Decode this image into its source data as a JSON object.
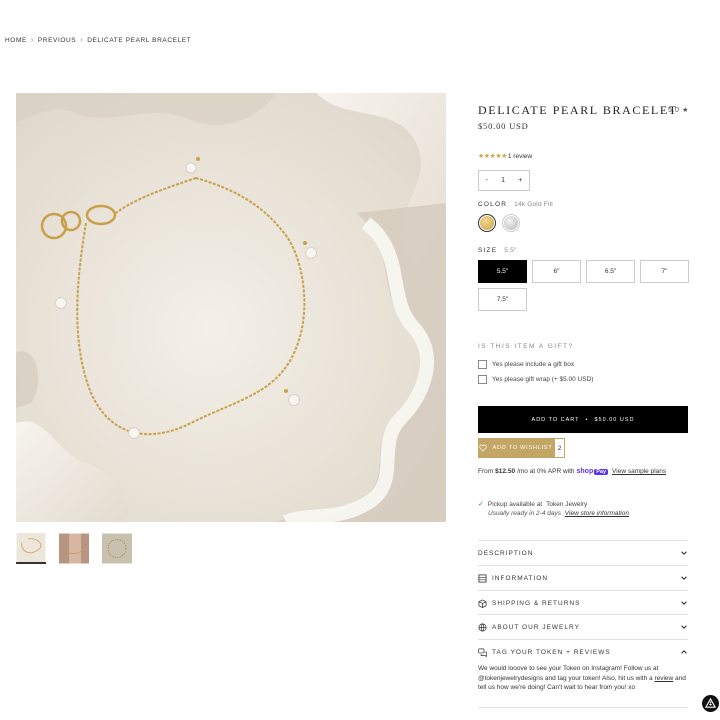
{
  "breadcrumb": [
    "HOME",
    "PREVIOUS",
    "DELICATE PEARL BRACELET"
  ],
  "breadcrumb_sep": "›",
  "product": {
    "title": "DELICATE PEARL BRACELET",
    "rating_score": "5.0",
    "rating_star": "★",
    "price": "$50.00 USD",
    "stars": "★★★★★",
    "review_count": "1 review"
  },
  "quantity": {
    "minus": "-",
    "value": "1",
    "plus": "+"
  },
  "color": {
    "label": "COLOR",
    "value": "14k Gold Fill",
    "swatches": [
      "gold",
      "silver"
    ],
    "gold_hex": "#d9b65a",
    "silver_hex": "#cfcfcf"
  },
  "size": {
    "label": "SIZE",
    "value": "5.5\"",
    "options": [
      "5.5\"",
      "6\"",
      "6.5\"",
      "7\"",
      "7.5\""
    ]
  },
  "gift": {
    "title": "IS THIS ITEM A GIFT?",
    "options": [
      "Yes please include a gift box",
      "Yes please gift wrap (+ $5.00 USD)"
    ]
  },
  "cart": {
    "label": "ADD TO CART",
    "sep": "•",
    "price": "$50.00 USD"
  },
  "wishlist": {
    "label": "ADD TO WISHLIST",
    "count": "2"
  },
  "installments": {
    "prefix": "From",
    "amount": "$12.50",
    "suffix": "/mo at 0% APR with",
    "shop": "shop",
    "pay": "Pay",
    "link": "View sample plans"
  },
  "pickup": {
    "prefix": "Pickup available at",
    "store": "Token Jewelry",
    "ready": "Usually ready in 2-4 days",
    "link": "View store information"
  },
  "accordions": [
    {
      "label": "DESCRIPTION"
    },
    {
      "label": "INFORMATION"
    },
    {
      "label": "SHIPPING & RETURNS"
    },
    {
      "label": "ABOUT OUR JEWELRY"
    },
    {
      "label": "TAG YOUR TOKEN + REVIEWS"
    }
  ],
  "tag_body": {
    "text1": "We would looove to see your Token on Instagram! Follow us at @tokenjewelrydesigns and tag your token! Also, hit us with a",
    "link": "review",
    "text2": "and tell us how we're doing! Can't wait to hear from you! xo"
  },
  "colors": {
    "accent_gold": "#c3a666",
    "black": "#000000",
    "star_gold": "#c8a84b"
  }
}
